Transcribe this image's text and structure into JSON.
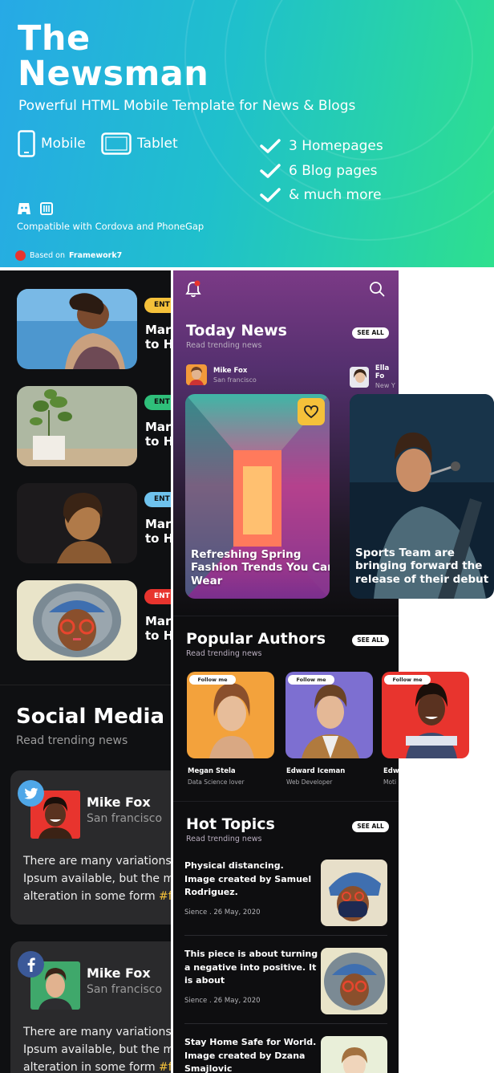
{
  "banner": {
    "title_line1": "The",
    "title_line2": "Newsman",
    "subtitle": "Powerful HTML Mobile Template for News & Blogs",
    "devices": [
      {
        "label": "Mobile"
      },
      {
        "label": "Tablet"
      }
    ],
    "features": [
      "3 Homepages",
      "6 Blog pages",
      "& much more"
    ],
    "compatible": "Compatible with Cordova and PhoneGap",
    "based_on_label": "Based on",
    "based_on_framework": "Framework7",
    "colors": {
      "gradient_start": "#27a9e6",
      "gradient_end": "#2ee08e"
    }
  },
  "left_panel": {
    "cards": [
      {
        "tag": "ENT",
        "tag_color": "#f5c13a",
        "line1": "Mar",
        "line2": "to H"
      },
      {
        "tag": "ENT",
        "tag_color": "#2fbf7a",
        "line1": "Mar",
        "line2": "to H"
      },
      {
        "tag": "ENT",
        "tag_color": "#6fc3ee",
        "line1": "Mar",
        "line2": "to H"
      },
      {
        "tag": "ENT",
        "tag_color": "#e8342e",
        "line1": "Mar",
        "line2": "to H"
      }
    ],
    "social_title": "Social Media T",
    "social_subtitle": "Read trending news",
    "posts": [
      {
        "network": "twitter-icon",
        "name": "Mike Fox",
        "location": "San francisco",
        "line1": "There are many variations",
        "line2": "Ipsum available, but the m",
        "line3_plain": "alteration in some form ",
        "line3_hashtag": "#f"
      },
      {
        "network": "facebook-icon",
        "name": "Mike Fox",
        "location": "San francisco",
        "line1": "There are many variations",
        "line2": "Ipsum available, but the m",
        "line3_plain": "alteration in some form ",
        "line3_hashtag": "#f"
      }
    ]
  },
  "phone": {
    "today": {
      "title": "Today News",
      "subtitle": "Read trending news",
      "see_all": "SEE ALL"
    },
    "story_authors": [
      {
        "name": "Mike Fox",
        "location": "San francisco"
      },
      {
        "name": "Ella Fo",
        "location": "New Y"
      }
    ],
    "stories": [
      {
        "caption_l1": "Refreshing Spring",
        "caption_l2": "Fashion Trends You Can",
        "caption_l3": "Wear"
      },
      {
        "caption_l1": "Sports Team are",
        "caption_l2": "bringing forward the",
        "caption_l3": "release of their debut"
      }
    ],
    "popular": {
      "title": "Popular Authors",
      "subtitle": "Read trending news",
      "see_all": "SEE ALL"
    },
    "authors": [
      {
        "follow": "Follow me",
        "name": "Megan Stela",
        "role": "Data Science lover"
      },
      {
        "follow": "Follow me",
        "name": "Edward Iceman",
        "role": "Web Developer"
      },
      {
        "follow": "Follow me",
        "name": "Edw",
        "role": "Moti"
      }
    ],
    "hot": {
      "title": "Hot Topics",
      "subtitle": "Read trending news",
      "see_all": "SEE ALL"
    },
    "topics": [
      {
        "l1": "Physical distancing.",
        "l2": "Image created by Samuel",
        "l3": "Rodriguez.",
        "date": "Sience . 26 May, 2020"
      },
      {
        "l1": "This piece is about turning",
        "l2": "a negative into positive. It",
        "l3": "is about",
        "date": "Sience . 26 May, 2020"
      },
      {
        "l1": "Stay Home Safe for World.",
        "l2": "Image created by Dzana",
        "l3": "Smajlovic",
        "date": ""
      }
    ],
    "colors": {
      "accent": "#f5c13a",
      "header_top": "#7b3a86"
    }
  }
}
